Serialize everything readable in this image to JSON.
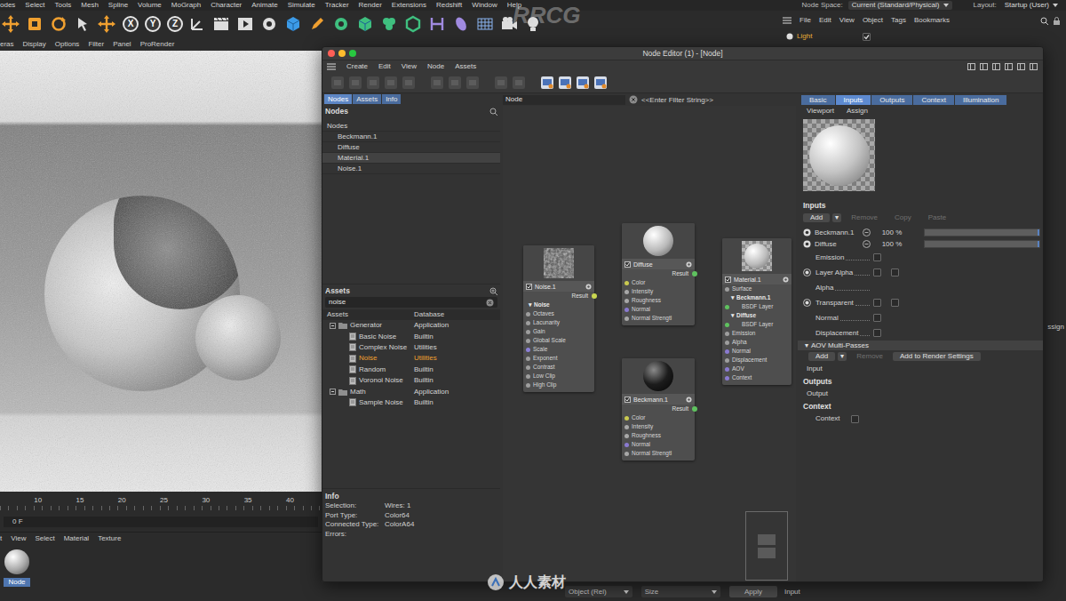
{
  "menubar": {
    "items": [
      "odes",
      "Select",
      "Tools",
      "Mesh",
      "Spline",
      "Volume",
      "MoGraph",
      "Character",
      "Animate",
      "Simulate",
      "Tracker",
      "Render",
      "Extensions",
      "Redshift",
      "Window",
      "Help"
    ],
    "node_space": {
      "label": "Node Space:",
      "value": "Current (Standard/Physical)"
    },
    "layout": {
      "label": "Layout:",
      "value": "Startup (User)"
    }
  },
  "toolbar": {
    "axis_buttons": [
      {
        "label": "X",
        "on": true
      },
      {
        "label": "Y",
        "on": true
      },
      {
        "label": "Z",
        "on": true
      }
    ]
  },
  "viewport": {
    "menu": [
      "eras",
      "Display",
      "Options",
      "Filter",
      "Panel",
      "ProRender"
    ]
  },
  "timeline": {
    "ticks": [
      "10",
      "15",
      "20",
      "25",
      "30",
      "35",
      "40"
    ],
    "frame": "0 F"
  },
  "material_manager": {
    "menu": [
      "t",
      "View",
      "Select",
      "Material",
      "Texture"
    ],
    "materials": [
      {
        "name": "Node",
        "selected": true
      }
    ]
  },
  "object_manager": {
    "menu": [
      "File",
      "Edit",
      "View",
      "Object",
      "Tags",
      "Bookmarks"
    ],
    "objects": [
      {
        "name": "Light",
        "selected": true,
        "visible": true
      }
    ],
    "fragment": "ssign",
    "footer": "Input"
  },
  "coordinates_bar": {
    "mode": "Object (Rel)",
    "size": "Size",
    "apply": "Apply"
  },
  "node_editor": {
    "title": "Node Editor (1) - [Node]",
    "menu": [
      "Create",
      "Edit",
      "View",
      "Node",
      "Assets"
    ],
    "toolbar": [
      {
        "on": false
      },
      {
        "on": false
      },
      {
        "on": false
      },
      {
        "on": false
      },
      {
        "on": false
      },
      {
        "on": false
      },
      {
        "on": false
      },
      {
        "on": false
      },
      {
        "on": false
      },
      {
        "on": false
      },
      {
        "on": true
      },
      {
        "on": true
      },
      {
        "on": true
      },
      {
        "on": true
      }
    ],
    "left_tabs": [
      {
        "label": "Nodes",
        "selected": true
      },
      {
        "label": "Assets",
        "selected": false
      },
      {
        "label": "Info",
        "selected": false
      }
    ],
    "nodes_panel": {
      "title": "Nodes",
      "items": [
        {
          "label": "Nodes",
          "depth": 0,
          "selected": false
        },
        {
          "label": "Beckmann.1",
          "depth": 1,
          "selected": false
        },
        {
          "label": "Diffuse",
          "depth": 1,
          "selected": false
        },
        {
          "label": "Material.1",
          "depth": 1,
          "selected": true
        },
        {
          "label": "Noise.1",
          "depth": 1,
          "selected": false
        }
      ]
    },
    "assets_panel": {
      "title": "Assets",
      "search": "noise",
      "columns": [
        "Assets",
        "Database"
      ],
      "rows": [
        {
          "label": "Generator",
          "database": "Application",
          "depth": 0,
          "kind": "folder",
          "expanded": true,
          "selected": false
        },
        {
          "label": "Basic Noise",
          "database": "Builtin",
          "depth": 1,
          "kind": "asset",
          "expanded": false,
          "selected": false
        },
        {
          "label": "Complex Noise",
          "database": "Utilities",
          "depth": 1,
          "kind": "asset",
          "expanded": false,
          "selected": false
        },
        {
          "label": "Noise",
          "database": "Utilities",
          "depth": 1,
          "kind": "asset",
          "expanded": false,
          "selected": true
        },
        {
          "label": "Random",
          "database": "Builtin",
          "depth": 1,
          "kind": "asset",
          "expanded": false,
          "selected": false
        },
        {
          "label": "Voronoi Noise",
          "database": "Builtin",
          "depth": 1,
          "kind": "asset",
          "expanded": false,
          "selected": false
        },
        {
          "label": "Math",
          "database": "Application",
          "depth": 0,
          "kind": "folder",
          "expanded": true,
          "selected": false
        },
        {
          "label": "Sample Noise",
          "database": "Builtin",
          "depth": 1,
          "kind": "asset",
          "expanded": false,
          "selected": false
        }
      ]
    },
    "info_panel": {
      "title": "Info",
      "rows": [
        {
          "label": "Selection:",
          "value": "Wires: 1"
        },
        {
          "label": "Port Type:",
          "value": "Color64"
        },
        {
          "label": "Connected Type:",
          "value": "ColorA64"
        },
        {
          "label": "Errors:"
        }
      ]
    },
    "canvas": {
      "path": "Node",
      "filter_placeholder": "<<Enter Filter String>>",
      "nodes": [
        {
          "title": "Noise.1",
          "kind": "texture",
          "enabled": true,
          "ports": [
            {
              "label": "Result",
              "kind": "output",
              "depth": 0,
              "color": "#c9d650"
            },
            {
              "label": "Noise",
              "kind": "group",
              "depth": 0,
              "toggle": "▾"
            },
            {
              "label": "Octaves",
              "kind": "input",
              "depth": 0,
              "color": "#9e9e9e"
            },
            {
              "label": "Lacunarity",
              "kind": "input",
              "depth": 0,
              "color": "#9e9e9e"
            },
            {
              "label": "Gain",
              "kind": "input",
              "depth": 0,
              "color": "#9e9e9e"
            },
            {
              "label": "Global Scale",
              "kind": "input",
              "depth": 0,
              "color": "#9e9e9e"
            },
            {
              "label": "Scale",
              "kind": "input",
              "depth": 0,
              "color": "#8c80d8"
            },
            {
              "label": "Exponent",
              "kind": "input",
              "depth": 0,
              "color": "#9e9e9e"
            },
            {
              "label": "Contrast",
              "kind": "input",
              "depth": 0,
              "color": "#9e9e9e"
            },
            {
              "label": "Low Clip",
              "kind": "input",
              "depth": 0,
              "color": "#9e9e9e"
            },
            {
              "label": "High Clip",
              "kind": "input",
              "depth": 0,
              "color": "#9e9e9e"
            }
          ]
        },
        {
          "title": "Diffuse",
          "kind": "bsdf-light",
          "enabled": true,
          "ports": [
            {
              "label": "Result",
              "kind": "output",
              "depth": 0,
              "color": "#5fc25f"
            },
            {
              "label": "Color",
              "kind": "input",
              "depth": 0,
              "color": "#c9c950"
            },
            {
              "label": "Intensity",
              "kind": "input",
              "depth": 0,
              "color": "#a8a8a8"
            },
            {
              "label": "Roughness",
              "kind": "input",
              "depth": 0,
              "color": "#a8a8a8"
            },
            {
              "label": "Normal",
              "kind": "input",
              "depth": 0,
              "color": "#8a7ad0"
            },
            {
              "label": "Normal Strengtl",
              "kind": "input",
              "depth": 0,
              "color": "#a8a8a8"
            }
          ]
        },
        {
          "title": "Beckmann.1",
          "kind": "bsdf-dark",
          "enabled": true,
          "ports": [
            {
              "label": "Result",
              "kind": "output",
              "depth": 0,
              "color": "#5fc25f"
            },
            {
              "label": "Color",
              "kind": "input",
              "depth": 0,
              "color": "#c9c950"
            },
            {
              "label": "Intensity",
              "kind": "input",
              "depth": 0,
              "color": "#a8a8a8"
            },
            {
              "label": "Roughness",
              "kind": "input",
              "depth": 0,
              "color": "#a8a8a8"
            },
            {
              "label": "Normal",
              "kind": "input",
              "depth": 0,
              "color": "#8a7ad0"
            },
            {
              "label": "Normal Strengtl",
              "kind": "input",
              "depth": 0,
              "color": "#a8a8a8"
            }
          ]
        },
        {
          "title": "Material.1",
          "kind": "material",
          "enabled": true,
          "ports": [
            {
              "label": "Surface",
              "kind": "input",
              "depth": 0,
              "color": "#9e9e9e"
            },
            {
              "label": "Beckmann.1",
              "kind": "group",
              "depth": 1,
              "toggle": "▾"
            },
            {
              "label": "BSDF Layer",
              "kind": "input",
              "depth": 2,
              "color": "#5fc25f"
            },
            {
              "label": "Diffuse",
              "kind": "group",
              "depth": 1,
              "toggle": "▾"
            },
            {
              "label": "BSDF Layer",
              "kind": "input",
              "depth": 2,
              "color": "#5fc25f"
            },
            {
              "label": "Emission",
              "kind": "input",
              "depth": 0,
              "color": "#9e9e9e"
            },
            {
              "label": "Alpha",
              "kind": "input",
              "depth": 0,
              "color": "#9e9e9e"
            },
            {
              "label": "Normal",
              "kind": "input",
              "depth": 0,
              "color": "#8a7ad0"
            },
            {
              "label": "Displacement",
              "kind": "input",
              "depth": 0,
              "color": "#9e9e9e"
            },
            {
              "label": "AOV",
              "kind": "input",
              "depth": 0,
              "color": "#8a7ad0"
            },
            {
              "label": "Context",
              "kind": "input",
              "depth": 0,
              "color": "#8a7ad0"
            }
          ]
        }
      ],
      "wires": [
        {
          "from": {
            "node": 0,
            "port": 0
          },
          "to": {
            "node": 1,
            "port": 3
          },
          "selected": true
        },
        {
          "from": {
            "node": 0,
            "port": 0
          },
          "to": {
            "node": 2,
            "port": 3
          },
          "selected": false
        },
        {
          "from": {
            "node": 1,
            "port": 0
          },
          "to": {
            "node": 3,
            "port": 4
          },
          "selected": false
        },
        {
          "from": {
            "node": 2,
            "port": 0
          },
          "to": {
            "node": 3,
            "port": 2
          },
          "selected": false
        }
      ]
    },
    "attributes": {
      "tabs": [
        {
          "label": "Basic",
          "selected": false
        },
        {
          "label": "Inputs",
          "selected": true
        },
        {
          "label": "Outputs",
          "selected": false
        },
        {
          "label": "Context",
          "selected": false
        },
        {
          "label": "Illumination",
          "selected": false
        }
      ],
      "subtabs": [
        "Viewport",
        "Assign"
      ],
      "inputs": {
        "title": "Inputs",
        "buttons": [
          {
            "label": "Add",
            "disabled": false
          },
          {
            "label": "▾",
            "disabled": false
          },
          {
            "label": "Remove",
            "disabled": true
          },
          {
            "label": "Copy",
            "disabled": true
          },
          {
            "label": "Paste",
            "disabled": true
          }
        ],
        "rows": [
          {
            "kind": "layer",
            "label": "Beckmann.1",
            "visible": true,
            "value": "100 %",
            "level": 1
          },
          {
            "kind": "layer",
            "label": "Diffuse",
            "visible": true,
            "value": "100 %",
            "level": 1
          },
          {
            "kind": "check",
            "label": "Emission",
            "checked": false
          },
          {
            "kind": "radio-pair",
            "label": "Layer Alpha",
            "enabled": true,
            "checked": [
              false,
              false
            ]
          },
          {
            "kind": "sub",
            "label": "Alpha"
          },
          {
            "kind": "radio-pair",
            "label": "Transparent",
            "enabled": true,
            "checked": [
              false,
              false
            ]
          },
          {
            "kind": "check",
            "label": "Normal",
            "checked": false
          },
          {
            "kind": "check",
            "label": "Displacement",
            "checked": false
          }
        ]
      },
      "aov": {
        "toggle": "▾",
        "title": "AOV Multi-Passes",
        "expanded": true,
        "buttons": [
          {
            "label": "Add",
            "disabled": false
          },
          {
            "label": "▾",
            "disabled": false
          },
          {
            "label": "Remove",
            "disabled": true
          },
          {
            "label": "Add to Render Settings",
            "disabled": false
          }
        ],
        "rows": [
          "Input"
        ]
      },
      "outputs": {
        "title": "Outputs",
        "rows": [
          "Output"
        ]
      },
      "context": {
        "title": "Context",
        "rows": [
          {
            "label": "Context",
            "checked": false
          }
        ]
      }
    }
  },
  "watermarks": [
    "RRCG",
    "人人素材"
  ]
}
